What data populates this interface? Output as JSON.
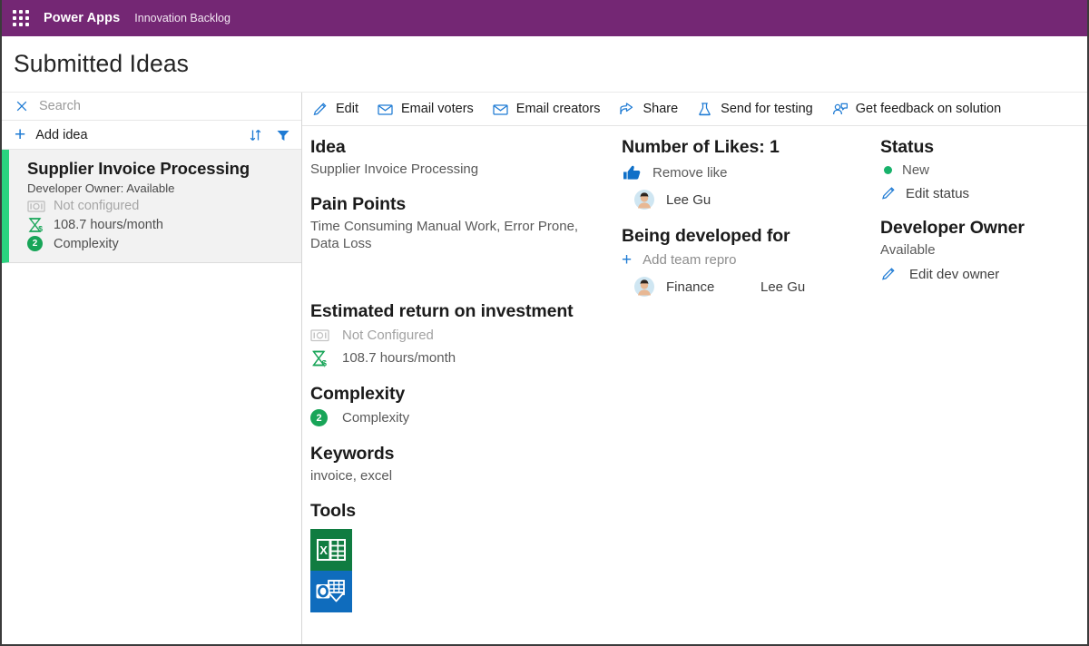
{
  "topbar": {
    "waffle_icon": "waffle-grid-icon",
    "brand": "Power Apps",
    "app_name": "Innovation Backlog"
  },
  "page": {
    "title": "Submitted Ideas"
  },
  "left_pane": {
    "search": {
      "clear_icon": "close-x-icon",
      "placeholder": "Search",
      "value": ""
    },
    "add_idea": {
      "plus_icon": "plus-icon",
      "label": "Add idea"
    },
    "sort_icon": "sort-arrows-icon",
    "filter_icon": "filter-funnel-icon",
    "items": [
      {
        "title": "Supplier Invoice Processing",
        "subtitle": "Developer Owner: Available",
        "cost_icon": "money-bill-icon",
        "cost_label": "Not configured",
        "hours_icon": "hourglass-dollar-icon",
        "hours_label": "108.7 hours/month",
        "complexity_badge": "2",
        "complexity_label": "Complexity",
        "accent_color": "#2ad37f",
        "selected": true
      }
    ]
  },
  "command_bar": {
    "commands": [
      {
        "icon": "pencil-edit-icon",
        "label": "Edit"
      },
      {
        "icon": "mail-envelope-icon",
        "label": "Email voters"
      },
      {
        "icon": "mail-envelope-icon",
        "label": "Email creators"
      },
      {
        "icon": "share-arrow-icon",
        "label": "Share"
      },
      {
        "icon": "flask-beaker-icon",
        "label": "Send for testing"
      },
      {
        "icon": "person-feedback-icon",
        "label": "Get feedback on solution"
      }
    ]
  },
  "detail": {
    "idea": {
      "heading": "Idea",
      "value": "Supplier Invoice Processing"
    },
    "pain_points": {
      "heading": "Pain Points",
      "value": "Time Consuming Manual Work, Error Prone, Data Loss"
    },
    "roi": {
      "heading": "Estimated return on investment",
      "cost_icon": "money-bill-icon",
      "cost_label": "Not Configured",
      "hours_icon": "hourglass-dollar-icon",
      "hours_label": "108.7 hours/month"
    },
    "complexity": {
      "heading": "Complexity",
      "badge": "2",
      "label": "Complexity"
    },
    "keywords": {
      "heading": "Keywords",
      "value": "invoice, excel"
    },
    "tools": {
      "heading": "Tools",
      "items": [
        {
          "icon": "excel-icon",
          "name": "Excel",
          "color": "#107C41"
        },
        {
          "icon": "outlook-icon",
          "name": "Outlook",
          "color": "#0F6CBD"
        }
      ]
    },
    "likes": {
      "heading": "Number of Likes: 1",
      "count": 1,
      "action_icon": "thumbs-up-filled-icon",
      "action_label": "Remove like",
      "voters": [
        {
          "avatar": "person-avatar",
          "name": "Lee Gu"
        }
      ]
    },
    "developed_for": {
      "heading": "Being developed for",
      "add_icon": "plus-icon",
      "add_label": "Add team repro",
      "teams": [
        {
          "avatar": "person-avatar",
          "team": "Finance",
          "person": "Lee Gu"
        }
      ]
    },
    "status": {
      "heading": "Status",
      "dot_color": "#18b26b",
      "value": "New",
      "edit_icon": "pencil-edit-icon",
      "edit_label": "Edit status"
    },
    "developer_owner": {
      "heading": "Developer Owner",
      "value": "Available",
      "edit_icon": "pencil-edit-icon",
      "edit_label": "Edit dev owner"
    }
  },
  "colors": {
    "brand_purple": "#742774",
    "accent_blue": "#1f7bd4",
    "accent_green": "#2ad37f",
    "complexity_green": "#18a558"
  }
}
